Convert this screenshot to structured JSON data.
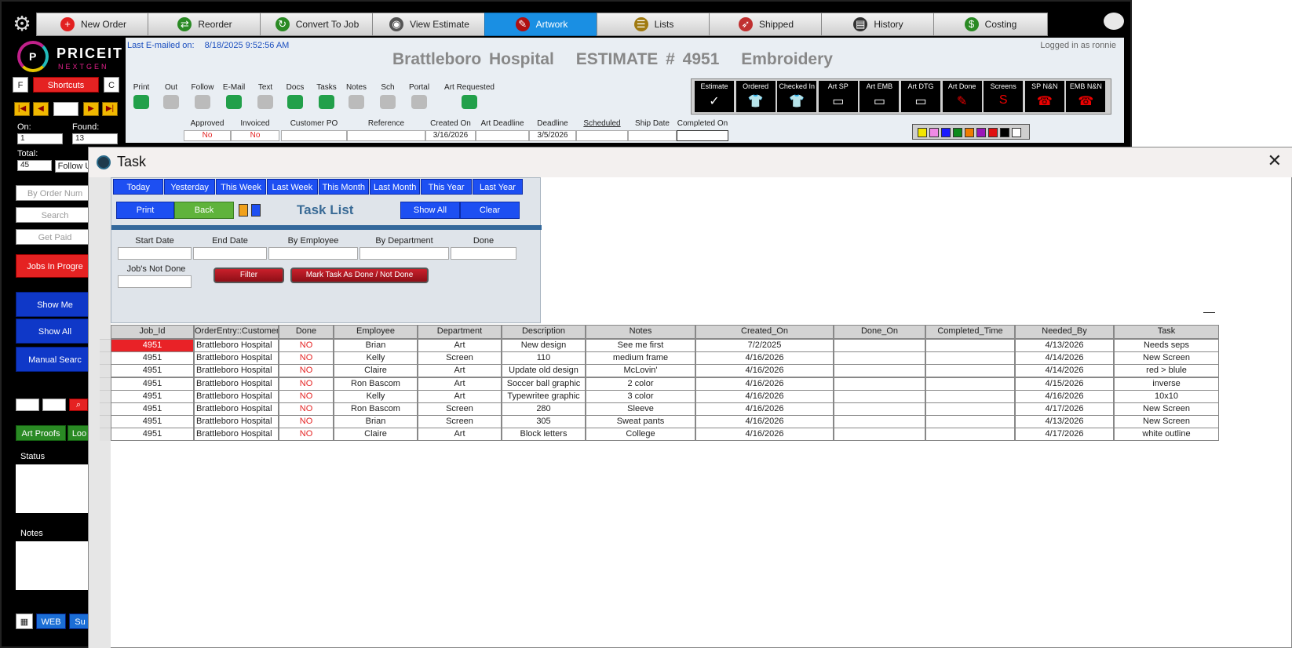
{
  "toolbar": {
    "buttons": [
      {
        "label": "New Order",
        "icon": "plus-circle-icon"
      },
      {
        "label": "Reorder",
        "icon": "reorder-arrows-icon"
      },
      {
        "label": "Convert To Job",
        "icon": "refresh-icon"
      },
      {
        "label": "View Estimate",
        "icon": "eye-icon"
      },
      {
        "label": "Artwork",
        "icon": "paintbrush-icon"
      },
      {
        "label": "Lists",
        "icon": "checklist-icon"
      },
      {
        "label": "Shipped",
        "icon": "rocket-icon"
      },
      {
        "label": "History",
        "icon": "book-icon"
      },
      {
        "label": "Costing",
        "icon": "dollar-icon"
      }
    ],
    "active": "Artwork"
  },
  "logo": {
    "title": "PRICEIT",
    "subtitle": "NEXTGEN",
    "letter": "P"
  },
  "sidebar": {
    "f_label": "F",
    "shortcuts_label": "Shortcuts",
    "c_label": "C",
    "on_label": "On:",
    "on_value": "1",
    "found_label": "Found:",
    "found_value": "13",
    "total_label": "Total:",
    "total_value": "45",
    "follow_label": "Follow U",
    "by_order_placeholder": "By Order Num",
    "search_label": "Search",
    "get_paid_label": "Get Paid",
    "jobs_in_progress_label": "Jobs In Progre",
    "show_me_label": "Show Me",
    "show_all_label": "Show All",
    "manual_search_label": "Manual Searc",
    "art_proofs_label": "Art Proofs",
    "look_label": "Loo",
    "status_label": "Status",
    "notes_label": "Notes",
    "web_label": "WEB",
    "su_label": "Su"
  },
  "header": {
    "last_emailed_label": "Last E-mailed on:",
    "last_emailed_value": "8/18/2025 9:52:56 AM",
    "logged_in": "Logged in as ronnie",
    "customer": "Brattleboro Hospital",
    "estimate_label": "ESTIMATE # 4951",
    "category": "Embroidery",
    "icons": [
      {
        "label": "Print",
        "icon": "printer-icon"
      },
      {
        "label": "Out",
        "icon": "out-icon"
      },
      {
        "label": "Follow",
        "icon": "follow-icon"
      },
      {
        "label": "E-Mail",
        "icon": "email-icon"
      },
      {
        "label": "Text",
        "icon": "text-icon"
      },
      {
        "label": "Docs",
        "icon": "paperclip-icon"
      },
      {
        "label": "Tasks",
        "icon": "tasks-icon"
      },
      {
        "label": "Notes",
        "icon": "notes-icon"
      },
      {
        "label": "Sch",
        "icon": "calendar-icon"
      },
      {
        "label": "Portal",
        "icon": "portal-icon"
      },
      {
        "label": "Art Requested",
        "icon": "brush-icon"
      }
    ],
    "stages": [
      {
        "label": "Estimate"
      },
      {
        "label": "Ordered"
      },
      {
        "label": "Checked In"
      },
      {
        "label": "Art SP"
      },
      {
        "label": "Art EMB"
      },
      {
        "label": "Art DTG"
      },
      {
        "label": "Art Done"
      },
      {
        "label": "Screens"
      },
      {
        "label": "SP N&N"
      },
      {
        "label": "EMB N&N"
      }
    ],
    "fields": [
      {
        "label": "Approved",
        "value": "No"
      },
      {
        "label": "Invoiced",
        "value": "No"
      },
      {
        "label": "Customer PO",
        "value": ""
      },
      {
        "label": "Reference",
        "value": ""
      },
      {
        "label": "Created On",
        "value": "3/16/2026"
      },
      {
        "label": "Art Deadline",
        "value": ""
      },
      {
        "label": "Deadline",
        "value": "3/5/2026"
      },
      {
        "label": "Scheduled",
        "value": ""
      },
      {
        "label": "Ship Date",
        "value": ""
      },
      {
        "label": "Completed On",
        "value": ""
      }
    ],
    "swatches": [
      "#f2e600",
      "#f08ae6",
      "#1a1aff",
      "#0c8a1a",
      "#f07c00",
      "#9a17b8",
      "#e01010",
      "#000000",
      "#ffffff"
    ]
  },
  "task_window": {
    "title": "Task",
    "close": "✕",
    "date_tabs": [
      "Today",
      "Yesterday",
      "This Week",
      "Last Week",
      "This Month",
      "Last Month",
      "This Year",
      "Last Year"
    ],
    "print_label": "Print",
    "back_label": "Back",
    "list_title": "Task List",
    "show_all_label": "Show All",
    "clear_label": "Clear",
    "filter_labels": [
      "Start Date",
      "End Date",
      "By Employee",
      "By Department",
      "Done"
    ],
    "jobs_not_done_label": "Job's Not Done",
    "filter_button": "Filter",
    "mark_done_button": "Mark Task As Done / Not Done",
    "columns": [
      "Job_Id",
      "OrderEntry::Customer",
      "Done",
      "Employee",
      "Department",
      "Description",
      "Notes",
      "Created_On",
      "Done_On",
      "Completed_Time",
      "Needed_By",
      "Task"
    ],
    "rows": [
      [
        "4951",
        "Brattleboro Hospital",
        "NO",
        "Brian",
        "Art",
        "New design",
        "See me first",
        "7/2/2025",
        "",
        "",
        "4/13/2026",
        "Needs seps"
      ],
      [
        "4951",
        "Brattleboro Hospital",
        "NO",
        "Kelly",
        "Screen",
        "110",
        "medium frame",
        "4/16/2026",
        "",
        "",
        "4/14/2026",
        "New Screen"
      ],
      [
        "4951",
        "Brattleboro Hospital",
        "NO",
        "Claire",
        "Art",
        "Update old design",
        "McLovin'",
        "4/16/2026",
        "",
        "",
        "4/14/2026",
        "red > blule"
      ],
      [
        "4951",
        "Brattleboro Hospital",
        "NO",
        "Ron Bascom",
        "Art",
        "Soccer ball graphic",
        "2 color",
        "4/16/2026",
        "",
        "",
        "4/15/2026",
        "inverse"
      ],
      [
        "4951",
        "Brattleboro Hospital",
        "NO",
        "Kelly",
        "Art",
        "Typewritee graphic",
        "3 color",
        "4/16/2026",
        "",
        "",
        "4/16/2026",
        "10x10"
      ],
      [
        "4951",
        "Brattleboro Hospital",
        "NO",
        "Ron Bascom",
        "Screen",
        "280",
        "Sleeve",
        "4/16/2026",
        "",
        "",
        "4/17/2026",
        "New Screen"
      ],
      [
        "4951",
        "Brattleboro Hospital",
        "NO",
        "Brian",
        "Screen",
        "305",
        "Sweat pants",
        "4/16/2026",
        "",
        "",
        "4/13/2026",
        "New Screen"
      ],
      [
        "4951",
        "Brattleboro Hospital",
        "NO",
        "Claire",
        "Art",
        "Block letters",
        "College",
        "4/16/2026",
        "",
        "",
        "4/17/2026",
        "white outline"
      ]
    ]
  },
  "colors": {
    "active_tab": "#1a8fe3",
    "task_blue": "#1d4ff2",
    "alert_red": "#e52222",
    "header_bg": "#e9eef3"
  }
}
